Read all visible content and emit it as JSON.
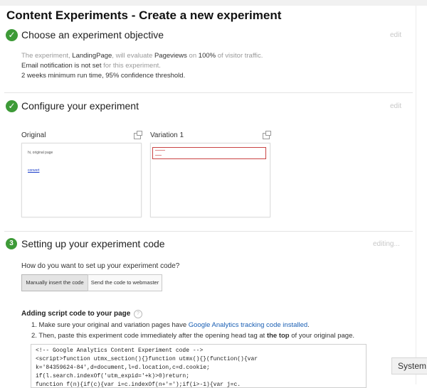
{
  "page_title": "Content Experiments - Create a new experiment",
  "steps": [
    {
      "icon": "checkmark-icon",
      "title": "Choose an experiment objective",
      "action": "edit"
    },
    {
      "icon": "checkmark-icon",
      "title": "Configure your experiment",
      "action": "edit"
    },
    {
      "number": "3",
      "title": "Setting up your experiment code",
      "action": "editing..."
    }
  ],
  "objective_summary": {
    "line1_pre": "The experiment, ",
    "experiment_name": "LandingPage",
    "line1_mid": ", will evaluate ",
    "metric": "Pageviews",
    "line1_on": " on ",
    "percent": "100%",
    "line1_post": " of visitor traffic.",
    "line2_a": "Email notification",
    "line2_b": " is not set",
    "line2_c": " for this experiment.",
    "line3": "2 weeks minimum run time, 95% confidence threshold."
  },
  "configure": {
    "original": {
      "label": "Original",
      "preview_text": "hi, original page",
      "preview_link": "convert"
    },
    "variation": {
      "label": "Variation 1"
    }
  },
  "setup": {
    "question": "How do you want to set up your experiment code?",
    "buttons": [
      "Manually insert the code",
      "Send the code to webmaster"
    ],
    "section_heading": "Adding script code to your page",
    "help": "?",
    "step1_pre": "1. Make sure your original and variation pages have ",
    "step1_link": "Google Analytics tracking code installed",
    "step1_post": ".",
    "step2_pre": "2. Then, paste this experiment code immediately after the opening head tag at ",
    "step2_bold": "the top",
    "step2_post": " of your original page.",
    "code_lines": [
      "<!-- Google Analytics Content Experiment code -->",
      "<script>function utmx_section(){}function utmx(){}(function(){var",
      "k='84359624-84',d=document,l=d.location,c=d.cookie;",
      "if(l.search.indexOf('utm_expid='+k)>0)return;",
      "function f(n){if(c){var i=c.indexOf(n+'=');if(i>-1){var j=c."
    ]
  },
  "system_tag": "System"
}
